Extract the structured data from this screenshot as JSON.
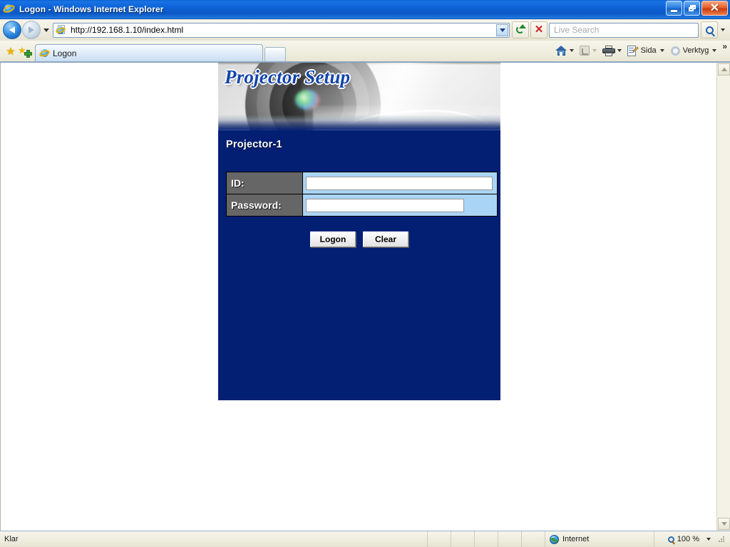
{
  "window": {
    "title": "Logon - Windows Internet Explorer",
    "icons": {
      "app": "ie-logo-icon",
      "minimize": "minimize-icon",
      "restore": "restore-icon",
      "close": "close-icon"
    }
  },
  "navigation": {
    "back": "back-arrow-icon",
    "forward": "forward-arrow-icon",
    "history_dropdown": "chevron-down-icon",
    "url": "http://192.168.1.10/index.html",
    "url_dropdown": "chevron-down-icon",
    "refresh": "refresh-icon",
    "stop": "stop-icon"
  },
  "search": {
    "placeholder": "Live Search",
    "value": "",
    "go_icon": "search-icon",
    "provider_caret": "chevron-down-icon"
  },
  "tabs": {
    "favorites_icon": "star-icon",
    "add_favorite_icon": "add-favorite-icon",
    "items": [
      {
        "label": "Logon",
        "favicon": "ie-page-icon",
        "active": true
      }
    ],
    "new_tab": "new-tab-icon"
  },
  "command_bar": {
    "home": {
      "label": "",
      "icon": "home-icon"
    },
    "feeds": {
      "label": "",
      "icon": "rss-icon"
    },
    "print": {
      "label": "",
      "icon": "printer-icon"
    },
    "page": {
      "label": "Sida",
      "icon": "page-icon"
    },
    "tools": {
      "label": "Verktyg",
      "icon": "gear-icon"
    },
    "overflow": "»"
  },
  "page": {
    "banner_title": "Projector Setup",
    "device_name": "Projector-1",
    "form": {
      "rows": [
        {
          "label": "ID:",
          "value": "",
          "field": "id"
        },
        {
          "label": "Password:",
          "value": "",
          "field": "password"
        }
      ],
      "buttons": [
        {
          "label": "Logon",
          "name": "logon"
        },
        {
          "label": "Clear",
          "name": "clear"
        }
      ]
    },
    "colors": {
      "panel_navy": "#031f74",
      "label_gray": "#666666",
      "field_blue": "#aad4f5",
      "title_blue": "#1144aa"
    }
  },
  "scrollbar": {
    "up": "scroll-up-icon",
    "down": "scroll-down-icon"
  },
  "status_bar": {
    "status": "Klar",
    "zone": "Internet",
    "zone_icon": "globe-icon",
    "zoom": "100 %",
    "zoom_icon": "zoom-icon",
    "zoom_caret": "chevron-down-icon"
  }
}
